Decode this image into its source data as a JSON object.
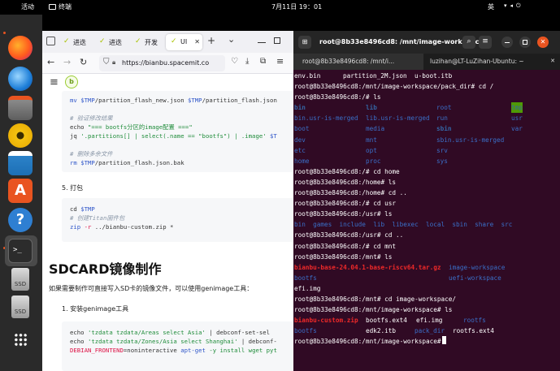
{
  "topbar": {
    "activities": "活动",
    "app_name": "终端",
    "clock": "7月11日 19：01",
    "ime": "英"
  },
  "dock": {
    "items": [
      "firefox",
      "thunderbird",
      "files",
      "rhythmbox",
      "writer",
      "app-center",
      "help",
      "terminal",
      "disk",
      "disk"
    ],
    "labels": [
      "SSD",
      "SSD"
    ]
  },
  "firefox": {
    "tabs": [
      {
        "label": "进迭"
      },
      {
        "label": "进迭"
      },
      {
        "label": "开发"
      },
      {
        "label": "UI"
      }
    ],
    "new_tab": "+",
    "tab_list": "⌄",
    "url": "https://bianbu.spacemit.co",
    "page": {
      "code1": [
        [
          [
            "mv ",
            "c-cmd"
          ],
          [
            "$TMP",
            "c-var"
          ],
          [
            "/partition_flash_new.json ",
            "c-pl"
          ],
          [
            "$TMP",
            "c-var"
          ],
          [
            "/partition_flash.json",
            "c-pl"
          ]
        ],
        [
          [
            "",
            "c-pl"
          ]
        ],
        [
          [
            "# 验证修改结果",
            "c-com"
          ]
        ],
        [
          [
            "echo ",
            "c-pl"
          ],
          [
            "\"=== bootfs分区的image配置 ===\"",
            "c-str"
          ]
        ],
        [
          [
            "jq ",
            "c-pl"
          ],
          [
            "'.partitions[] | select(.name == \"bootfs\") | .image'",
            "c-str"
          ],
          [
            " $T",
            "c-var"
          ]
        ],
        [
          [
            "",
            "c-pl"
          ]
        ],
        [
          [
            "# 删除多余文件",
            "c-com"
          ]
        ],
        [
          [
            "rm ",
            "c-cmd"
          ],
          [
            "$TMP",
            "c-var"
          ],
          [
            "/partition_flash.json.bak",
            "c-pl"
          ]
        ]
      ],
      "step5": "5. 打包",
      "code2": [
        [
          [
            "cd ",
            "c-pl"
          ],
          [
            "$TMP",
            "c-var"
          ]
        ],
        [
          [
            "# 创建Titan固件包",
            "c-com"
          ]
        ],
        [
          [
            "zip ",
            "c-cmd"
          ],
          [
            "-r",
            "c-key"
          ],
          [
            " ../bianbu-custom.zip *",
            "c-pl"
          ]
        ]
      ],
      "heading": "SDCARD镜像制作",
      "para": "如果需要制作可直接写入SD卡的镜像文件，可以使用genimage工具：",
      "step1": "1. 安装genimage工具",
      "code3": [
        [
          [
            "echo ",
            "c-pl"
          ],
          [
            "'tzdata tzdata/Areas select Asia'",
            "c-str"
          ],
          [
            " | debconf-set-sel",
            "c-pl"
          ]
        ],
        [
          [
            "echo ",
            "c-pl"
          ],
          [
            "'tzdata tzdata/Zones/Asia select Shanghai'",
            "c-str"
          ],
          [
            " | debconf-",
            "c-pl"
          ]
        ],
        [
          [
            "DEBIAN_FRONTEND",
            "c-key"
          ],
          [
            "=noninteractive ",
            "c-pl"
          ],
          [
            "apt-get",
            "c-cmd"
          ],
          [
            " -y install wget pyt",
            "c-str"
          ]
        ]
      ]
    }
  },
  "terminal": {
    "title": "root@8b33e8496cd8: /mnt/image-workspace",
    "tabs": [
      "root@8b33e8496cd8: /mnt/i...",
      "luzihan@LT-LuZihan-Ubuntu: ~"
    ],
    "lines": [
      [
        [
          "env.bin",
          "",
          0
        ],
        [
          "partition_2M.json",
          "",
          60
        ],
        [
          "u-boot.itb",
          "",
          148
        ]
      ],
      [
        [
          "root@8b33e8496cd8:/mnt/image-workspace/pack_dir# cd /",
          "",
          0
        ]
      ],
      [
        [
          "root@8b33e8496cd8:/# ls",
          "",
          0
        ]
      ],
      [
        [
          "bin",
          "blue",
          0
        ],
        [
          "lib",
          "blue",
          88
        ],
        [
          "root",
          "dblue",
          175
        ],
        [
          "tmp",
          "tmp",
          267
        ]
      ],
      [
        [
          "bin.usr-is-merged",
          "dblue",
          0
        ],
        [
          "lib.usr-is-merged",
          "dblue",
          88
        ],
        [
          "run",
          "dblue",
          175
        ],
        [
          "usr",
          "dblue",
          267
        ]
      ],
      [
        [
          "boot",
          "dblue",
          0
        ],
        [
          "media",
          "dblue",
          88
        ],
        [
          "sbin",
          "blue",
          175
        ],
        [
          "var",
          "dblue",
          267
        ]
      ],
      [
        [
          "dev",
          "dblue",
          0
        ],
        [
          "mnt",
          "dblue",
          88
        ],
        [
          "sbin.usr-is-merged",
          "dblue",
          175
        ]
      ],
      [
        [
          "etc",
          "dblue",
          0
        ],
        [
          "opt",
          "dblue",
          88
        ],
        [
          "srv",
          "dblue",
          175
        ]
      ],
      [
        [
          "home",
          "dblue",
          0
        ],
        [
          "proc",
          "dblue",
          88
        ],
        [
          "sys",
          "dblue",
          175
        ]
      ],
      [
        [
          "root@8b33e8496cd8:/# cd home",
          "",
          0
        ]
      ],
      [
        [
          "root@8b33e8496cd8:/home# ls",
          "",
          0
        ]
      ],
      [
        [
          "root@8b33e8496cd8:/home# cd ..",
          "",
          0
        ]
      ],
      [
        [
          "root@8b33e8496cd8:/# cd usr",
          "",
          0
        ]
      ],
      [
        [
          "root@8b33e8496cd8:/usr# ls",
          "",
          0
        ]
      ],
      [
        [
          "bin  games  include  lib  libexec  local  sbin  share  src",
          "dblue",
          0
        ]
      ],
      [
        [
          "root@8b33e8496cd8:/usr# cd ..",
          "",
          0
        ]
      ],
      [
        [
          "root@8b33e8496cd8:/# cd mnt",
          "",
          0
        ]
      ],
      [
        [
          "root@8b33e8496cd8:/mnt# ls",
          "",
          0
        ]
      ],
      [
        [
          "bianbu-base-24.04.1-base-riscv64.tar.gz",
          "red",
          0
        ],
        [
          "image-workspace",
          "dblue",
          190
        ]
      ],
      [
        [
          "bootfs",
          "dblue",
          0
        ],
        [
          "uefi-workspace",
          "dblue",
          190
        ]
      ],
      [
        [
          "efi.img",
          "",
          0
        ]
      ],
      [
        [
          "root@8b33e8496cd8:/mnt# cd image-workspace/",
          "",
          0
        ]
      ],
      [
        [
          "root@8b33e8496cd8:/mnt/image-workspace# ls",
          "",
          0
        ]
      ],
      [
        [
          "bianbu-custom.zip",
          "red",
          0
        ],
        [
          "bootfs.ext4",
          "",
          88
        ],
        [
          "efi.img",
          "",
          150
        ],
        [
          "rootfs",
          "dblue",
          208
        ]
      ],
      [
        [
          "bootfs",
          "dblue",
          0
        ],
        [
          "edk2.itb",
          "",
          88
        ],
        [
          "pack_dir",
          "dblue",
          148
        ],
        [
          "rootfs.ext4",
          "",
          195
        ]
      ],
      [
        [
          "root@8b33e8496cd8:/mnt/image-workspace#",
          "",
          0
        ]
      ]
    ]
  },
  "colors": {
    "terminal_bg": "#300a24",
    "accent": "#e95420"
  }
}
